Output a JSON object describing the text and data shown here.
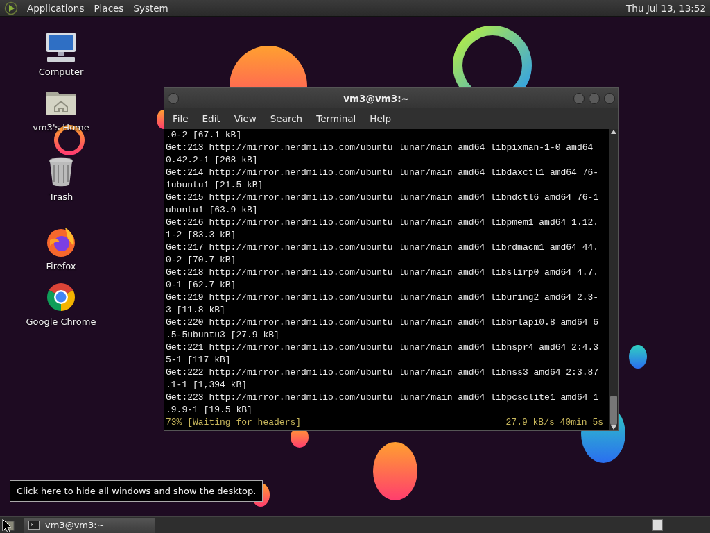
{
  "top_panel": {
    "menus": [
      "Applications",
      "Places",
      "System"
    ],
    "clock": "Thu Jul 13, 13:52"
  },
  "desktop_icons": [
    {
      "label": "Computer",
      "kind": "computer"
    },
    {
      "label": "vm3's Home",
      "kind": "home"
    },
    {
      "label": "Trash",
      "kind": "trash"
    },
    {
      "label": "Firefox",
      "kind": "firefox"
    },
    {
      "label": "Google Chrome",
      "kind": "chrome"
    }
  ],
  "terminal": {
    "title": "vm3@vm3:~",
    "menus": [
      "File",
      "Edit",
      "View",
      "Search",
      "Terminal",
      "Help"
    ],
    "lines": [
      ".0-2 [67.1 kB]",
      "Get:213 http://mirror.nerdmilio.com/ubuntu lunar/main amd64 libpixman-1-0 amd64",
      "0.42.2-1 [268 kB]",
      "Get:214 http://mirror.nerdmilio.com/ubuntu lunar/main amd64 libdaxctl1 amd64 76-",
      "1ubuntu1 [21.5 kB]",
      "Get:215 http://mirror.nerdmilio.com/ubuntu lunar/main amd64 libndctl6 amd64 76-1",
      "ubuntu1 [63.9 kB]",
      "Get:216 http://mirror.nerdmilio.com/ubuntu lunar/main amd64 libpmem1 amd64 1.12.",
      "1-2 [83.3 kB]",
      "Get:217 http://mirror.nerdmilio.com/ubuntu lunar/main amd64 librdmacm1 amd64 44.",
      "0-2 [70.7 kB]",
      "Get:218 http://mirror.nerdmilio.com/ubuntu lunar/main amd64 libslirp0 amd64 4.7.",
      "0-1 [62.7 kB]",
      "Get:219 http://mirror.nerdmilio.com/ubuntu lunar/main amd64 liburing2 amd64 2.3-",
      "3 [11.8 kB]",
      "Get:220 http://mirror.nerdmilio.com/ubuntu lunar/main amd64 libbrlapi0.8 amd64 6",
      ".5-5ubuntu3 [27.9 kB]",
      "Get:221 http://mirror.nerdmilio.com/ubuntu lunar/main amd64 libnspr4 amd64 2:4.3",
      "5-1 [117 kB]",
      "Get:222 http://mirror.nerdmilio.com/ubuntu lunar/main amd64 libnss3 amd64 2:3.87",
      ".1-1 [1,394 kB]",
      "Get:223 http://mirror.nerdmilio.com/ubuntu lunar/main amd64 libpcsclite1 amd64 1",
      ".9.9-1 [19.5 kB]"
    ],
    "status": {
      "progress": "73% [Waiting for headers]",
      "rate": "27.9 kB/s 40min 5s"
    }
  },
  "tooltip": "Click here to hide all windows and show the desktop.",
  "taskbar": {
    "windows": [
      {
        "label": "vm3@vm3:~"
      }
    ]
  }
}
